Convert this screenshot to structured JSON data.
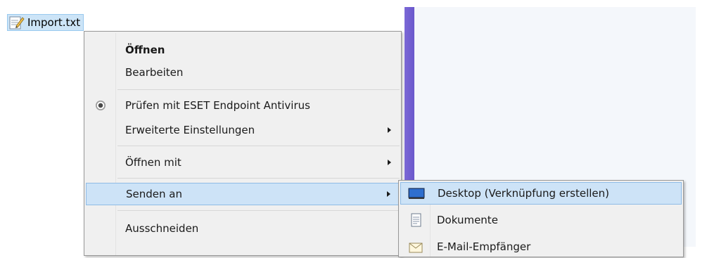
{
  "file": {
    "name": "Import.txt",
    "icon": "text-file-icon"
  },
  "context_menu": {
    "items": [
      {
        "label": "Öffnen",
        "bold": true
      },
      {
        "label": "Bearbeiten"
      },
      {
        "label": "Prüfen mit ESET Endpoint Antivirus",
        "icon": "eset-icon"
      },
      {
        "label": "Erweiterte Einstellungen",
        "submenu": true
      },
      {
        "label": "Öffnen mit",
        "submenu": true
      },
      {
        "label": "Senden an",
        "submenu": true,
        "highlighted": true
      },
      {
        "label": "Ausschneiden"
      }
    ]
  },
  "send_to_submenu": {
    "items": [
      {
        "label": "Desktop (Verknüpfung erstellen)",
        "icon": "desktop-icon",
        "highlighted": true
      },
      {
        "label": "Dokumente",
        "icon": "document-icon"
      },
      {
        "label": "E-Mail-Empfänger",
        "icon": "mail-icon"
      }
    ]
  },
  "colors": {
    "highlight": "#cde3f7",
    "window_edge": "#7b68d6"
  }
}
